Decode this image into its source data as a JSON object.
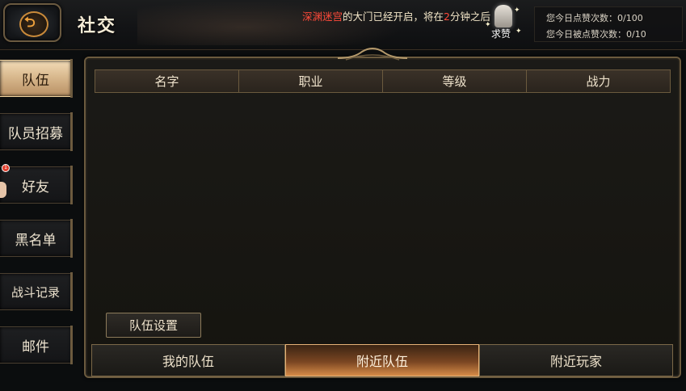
{
  "header": {
    "back_icon": "back-arrow-icon",
    "title": "社交",
    "notice": {
      "part1": "深渊迷宫",
      "part2": "的大门已经开启，将在",
      "part3": "2",
      "part4": "分钟之后"
    },
    "praise_label": "求赞",
    "stats": {
      "give_likes": "您今日点赞次数：0/100",
      "received_likes": "您今日被点赞次数：0/10"
    }
  },
  "sidebar": {
    "items": [
      {
        "label": "队伍",
        "active": true
      },
      {
        "label": "队员招募",
        "active": false
      },
      {
        "label": "好友",
        "active": false,
        "badge": "1"
      },
      {
        "label": "黑名单",
        "active": false
      },
      {
        "label": "战斗记录",
        "active": false
      },
      {
        "label": "邮件",
        "active": false
      }
    ]
  },
  "table": {
    "columns": [
      "名字",
      "职业",
      "等级",
      "战力"
    ],
    "rows": []
  },
  "panel": {
    "team_settings_label": "队伍设置"
  },
  "bottom_tabs": [
    {
      "label": "我的队伍",
      "active": false
    },
    {
      "label": "附近队伍",
      "active": true
    },
    {
      "label": "附近玩家",
      "active": false
    }
  ],
  "colors": {
    "accent_gold": "#6b5a3e",
    "active_tab": "#d68b48",
    "notice_red": "#ff4a3a"
  }
}
